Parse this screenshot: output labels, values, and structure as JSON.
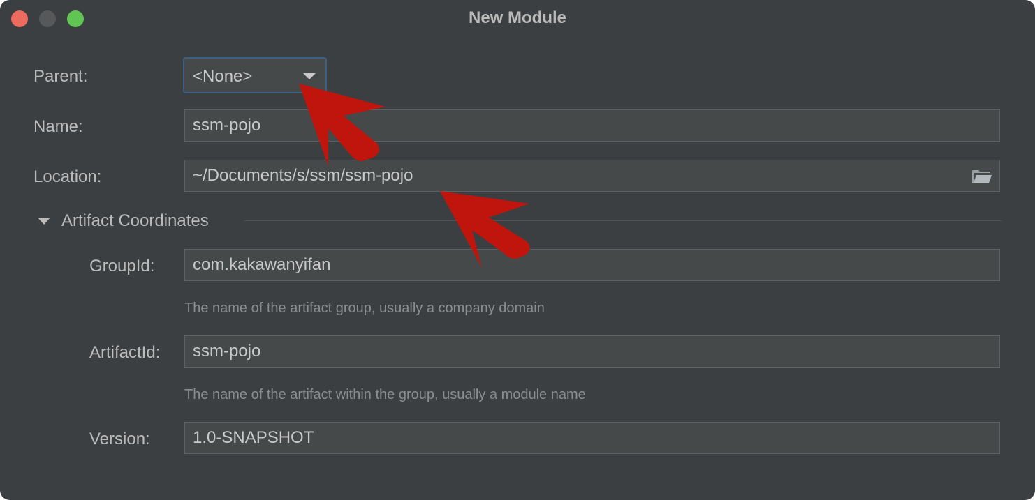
{
  "window": {
    "title": "New Module"
  },
  "form": {
    "parent": {
      "label": "Parent:",
      "value": "<None>"
    },
    "name": {
      "label": "Name:",
      "value": "ssm-pojo"
    },
    "location": {
      "label": "Location:",
      "value": "~/Documents/s/ssm/ssm-pojo"
    },
    "artifact_section": {
      "title": "Artifact Coordinates",
      "group_id": {
        "label": "GroupId:",
        "value": "com.kakawanyifan",
        "hint": "The name of the artifact group, usually a company domain"
      },
      "artifact_id": {
        "label": "ArtifactId:",
        "value": "ssm-pojo",
        "hint": "The name of the artifact within the group, usually a module name"
      },
      "version": {
        "label": "Version:",
        "value": "1.0-SNAPSHOT"
      }
    }
  },
  "icons": {
    "browse": "folder-icon",
    "expand": "triangle-down-icon",
    "dropdown": "chevron-down-icon"
  },
  "colors": {
    "background": "#3c3f41",
    "field": "#45494a",
    "focus_border": "#3d6185",
    "annotation_arrow": "#c0150d"
  }
}
